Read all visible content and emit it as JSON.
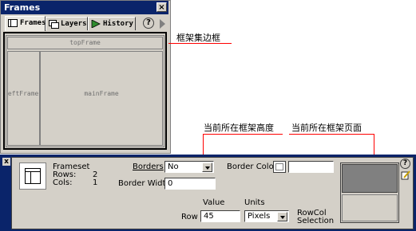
{
  "frames_panel": {
    "title": "Frames",
    "close": "×",
    "tabs": [
      {
        "label": "Frames",
        "icon": "frames-tab-icon"
      },
      {
        "label": "Layers",
        "icon": "layers-tab-icon"
      },
      {
        "label": "History",
        "icon": "history-tab-icon"
      }
    ],
    "help": "?",
    "top_frame": "topFrame",
    "left_frame": "leftFrame",
    "main_frame": "mainFrame"
  },
  "callouts": {
    "frameset_border": "框架集边框",
    "current_frame_height": "当前所在框架高度",
    "current_frame_page": "当前所在框架页面"
  },
  "properties": {
    "close": "x",
    "type": "Frameset",
    "rows_label": "Rows:",
    "rows_value": "2",
    "cols_label": "Cols:",
    "cols_value": "1",
    "borders_label": "Borders",
    "borders_value": "No",
    "border_width_label": "Border Width",
    "border_width_value": "0",
    "border_color_label": "Border Color",
    "border_color_value": "",
    "value_label": "Value",
    "units_label": "Units",
    "row_label": "Row",
    "row_value": "45",
    "units_value": "Pixels",
    "rowcol_label_1": "RowCol",
    "rowcol_label_2": "Selection",
    "help": "?"
  },
  "colors": {
    "titlebar": "#0a246a",
    "panel": "#d4d0c8",
    "callout_line": "#ff0000",
    "selected_row": "#808080"
  }
}
